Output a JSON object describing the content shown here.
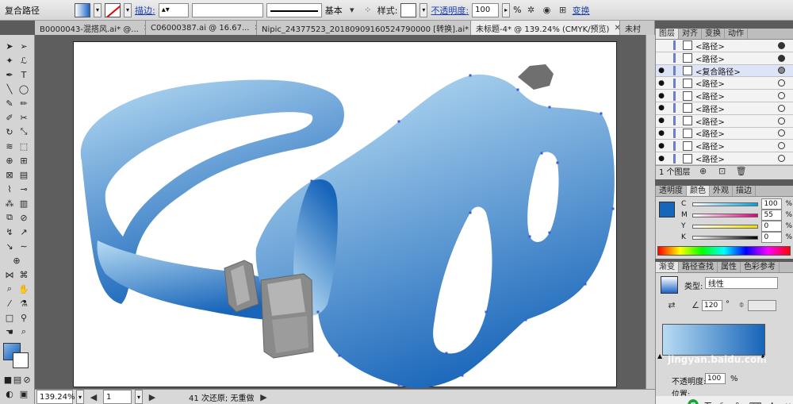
{
  "control_bar": {
    "object_type": "复合路径",
    "stroke_label": "描边:",
    "stroke_profile": "基本",
    "style_label": "样式:",
    "opacity_label": "不透明度:",
    "opacity_value": "100",
    "opacity_unit": "%",
    "transform_label": "变换"
  },
  "tabs": [
    {
      "label": "B0000043-混搭风.ai* @..."
    },
    {
      "label": "C06000387.ai @ 16.67..."
    },
    {
      "label": "Nipic_24377523_20180909160524790000 [转换].ai*"
    },
    {
      "label": "未标题-4* @ 139.24% (CMYK/预览)"
    },
    {
      "label": "未村"
    }
  ],
  "status_bar": {
    "zoom": "139.24%",
    "artboard": "1",
    "message": "41 次还原; 无重做"
  },
  "layers_panel": {
    "tabs": [
      "图层",
      "对齐",
      "变换",
      "动作"
    ],
    "rows": [
      {
        "name": "<路径>",
        "visible": false,
        "target": "filled"
      },
      {
        "name": "<路径>",
        "visible": false,
        "target": "filled"
      },
      {
        "name": "<复合路径>",
        "visible": true,
        "target": "selected"
      },
      {
        "name": "<路径>",
        "visible": true,
        "target": "empty"
      },
      {
        "name": "<路径>",
        "visible": true,
        "target": "empty"
      },
      {
        "name": "<路径>",
        "visible": true,
        "target": "empty"
      },
      {
        "name": "<路径>",
        "visible": true,
        "target": "empty"
      },
      {
        "name": "<路径>",
        "visible": true,
        "target": "empty"
      },
      {
        "name": "<路径>",
        "visible": true,
        "target": "empty"
      },
      {
        "name": "<路径>",
        "visible": true,
        "target": "empty"
      }
    ],
    "footer": "1 个图层"
  },
  "color_panel": {
    "tabs": [
      "透明度",
      "颜色",
      "外观",
      "描边"
    ],
    "channels": [
      {
        "label": "C",
        "value": "100"
      },
      {
        "label": "M",
        "value": "55"
      },
      {
        "label": "Y",
        "value": "0"
      },
      {
        "label": "K",
        "value": "0"
      }
    ],
    "fill_color": "#1565b8"
  },
  "gradient_panel": {
    "tabs": [
      "渐变",
      "路径查找",
      "属性",
      "色彩参考"
    ],
    "type_label": "类型:",
    "type_value": "线性",
    "angle_value": "120",
    "angle_unit": "°",
    "opacity_label": "不透明度:",
    "opacity_value": "100",
    "opacity_unit": "%",
    "location_label": "位置:"
  },
  "watermark": "jingyan.baidu.com",
  "tray": {
    "ime_label": "五"
  },
  "colors": {
    "goggle_light": "#b8dcf3",
    "goggle_dark": "#1764b9",
    "buckle": "#8a8a8a",
    "anchor": "#3b5bdb"
  }
}
